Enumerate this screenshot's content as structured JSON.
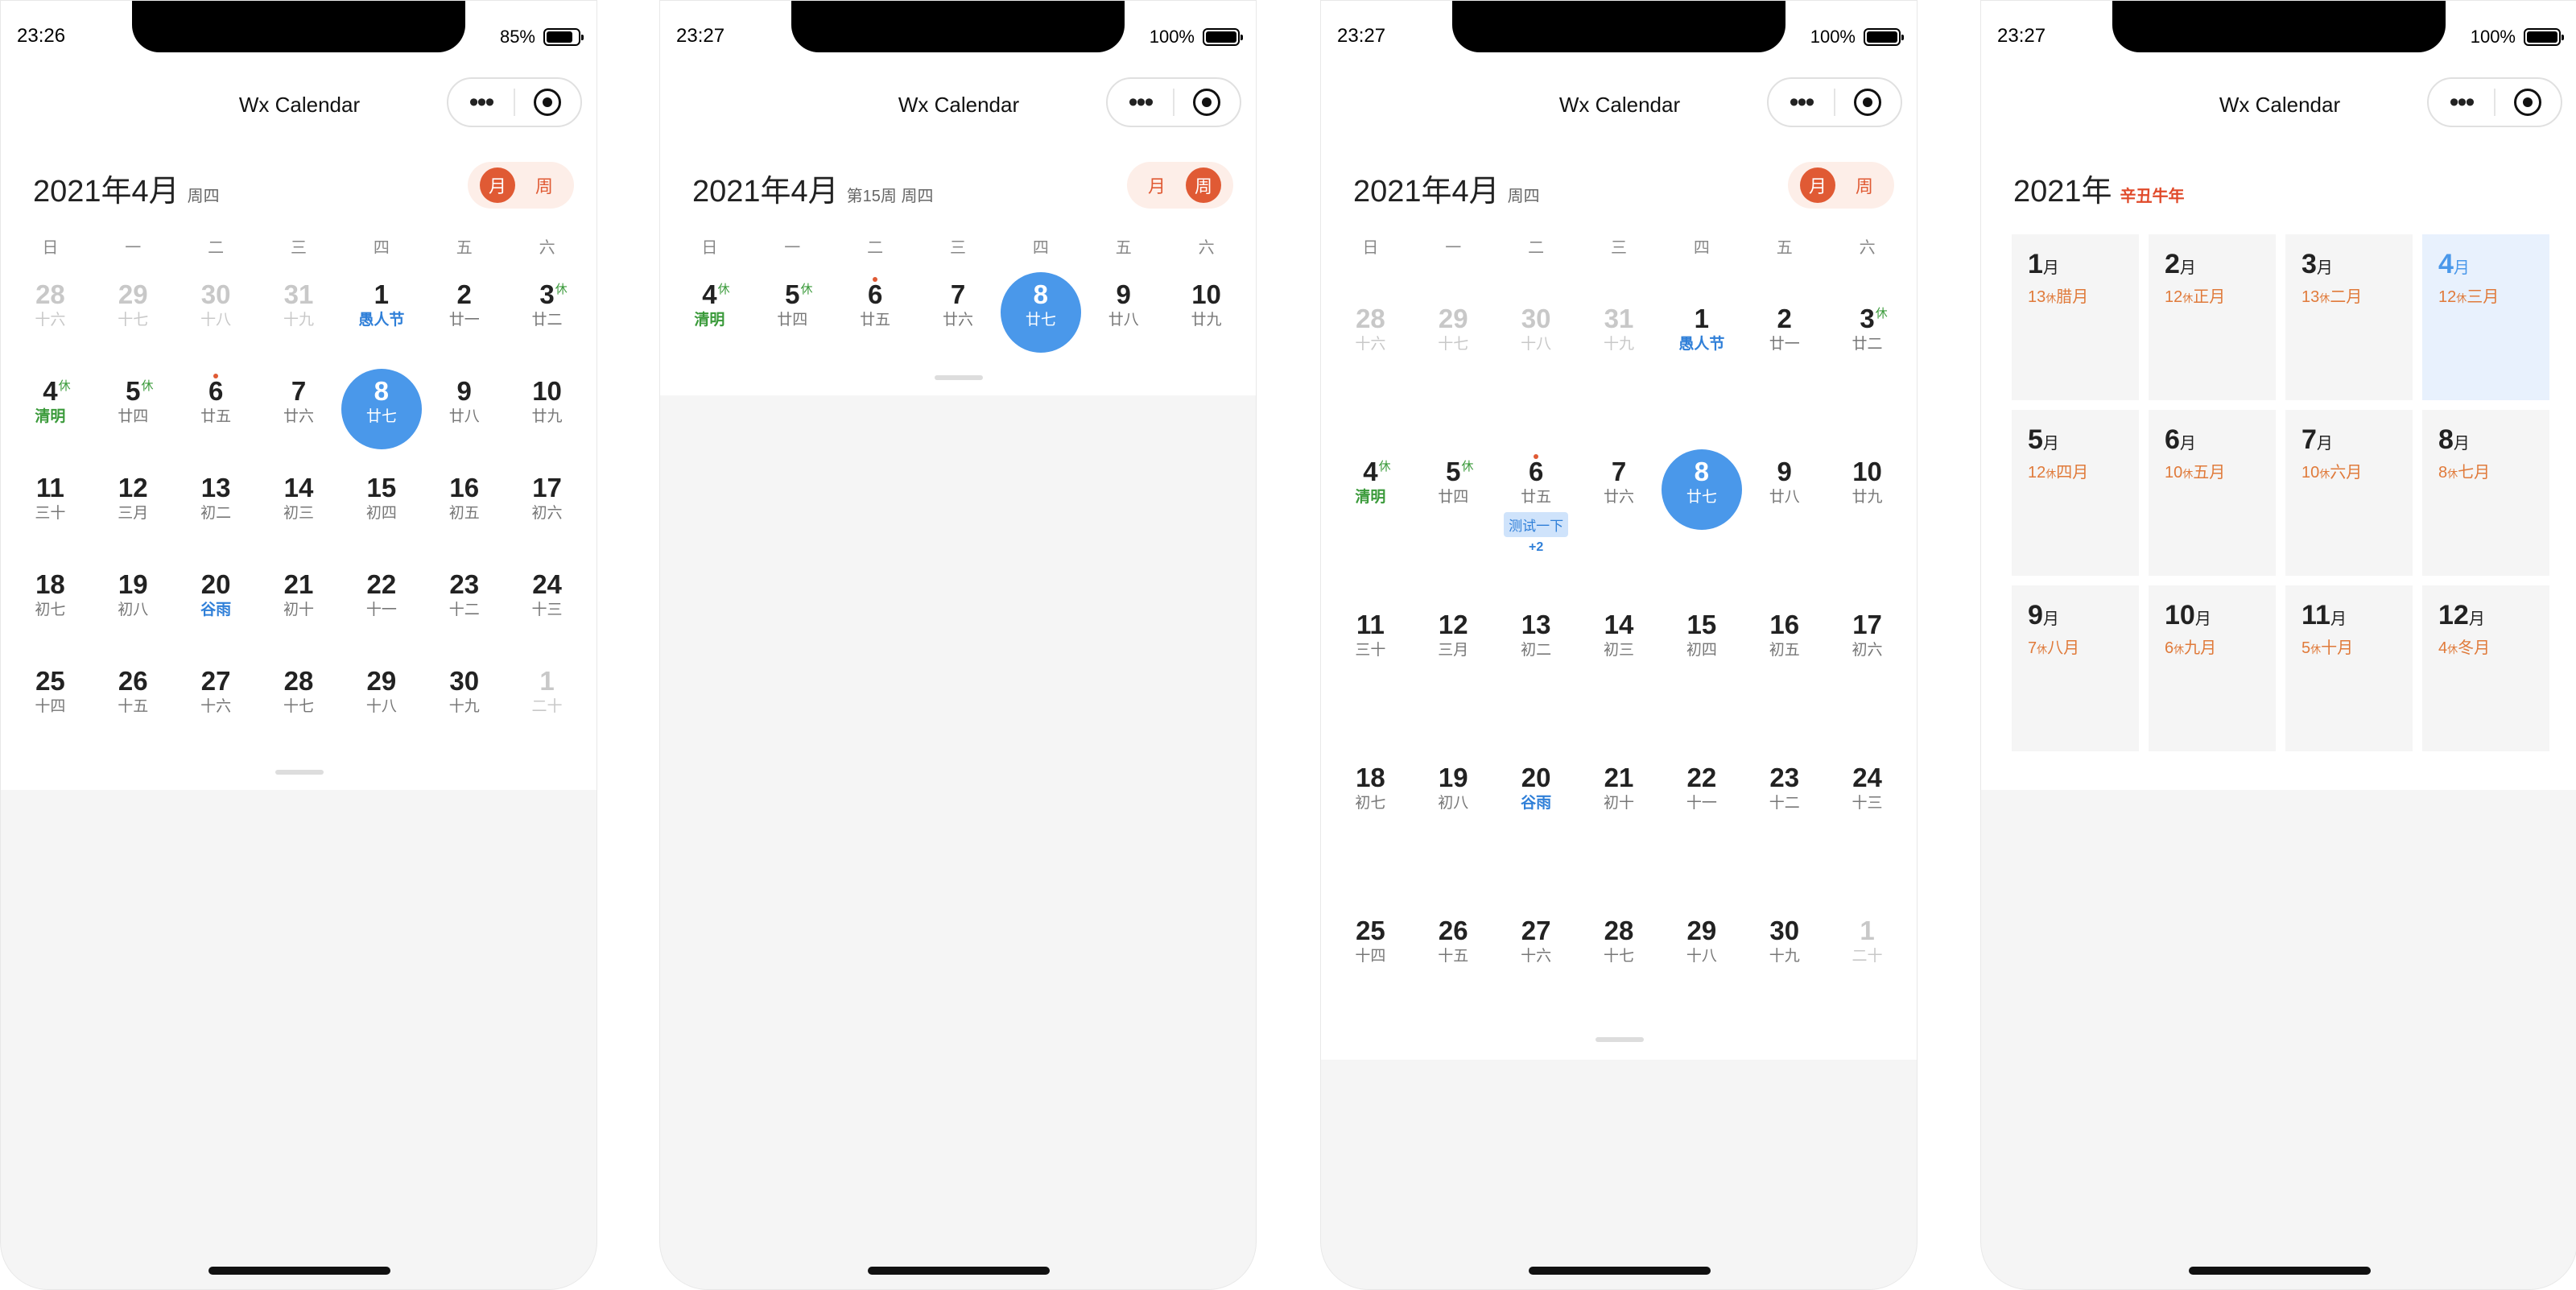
{
  "app_title": "Wx Calendar",
  "capsule": {
    "more": "•••"
  },
  "weekdays": [
    "日",
    "一",
    "二",
    "三",
    "四",
    "五",
    "六"
  ],
  "switch": {
    "month": "月",
    "week": "周"
  },
  "screens": [
    {
      "status": {
        "time": "23:26",
        "battery": "85%",
        "battery_level": 0.85
      },
      "header": {
        "year_month": "2021年4月",
        "sub": "周四"
      },
      "mode": "month"
    },
    {
      "status": {
        "time": "23:27",
        "battery": "100%",
        "battery_level": 1.0
      },
      "header": {
        "year_month": "2021年4月",
        "sub": "第15周 周四"
      },
      "mode": "week"
    },
    {
      "status": {
        "time": "23:27",
        "battery": "100%",
        "battery_level": 1.0
      },
      "header": {
        "year_month": "2021年4月",
        "sub": "周四"
      },
      "mode": "month",
      "event": {
        "label": "测试一下",
        "more": "+2"
      }
    },
    {
      "status": {
        "time": "23:27",
        "battery": "100%",
        "battery_level": 1.0
      },
      "header": {
        "year_month": "2021年",
        "sub": "辛丑牛年"
      },
      "mode": "year"
    }
  ],
  "month_days": [
    [
      {
        "d": "28",
        "l": "十六",
        "dim": true
      },
      {
        "d": "29",
        "l": "十七",
        "dim": true
      },
      {
        "d": "30",
        "l": "十八",
        "dim": true
      },
      {
        "d": "31",
        "l": "十九",
        "dim": true
      },
      {
        "d": "1",
        "l": "愚人节",
        "fes": true
      },
      {
        "d": "2",
        "l": "廿一"
      },
      {
        "d": "3",
        "l": "廿二",
        "rest": "休"
      }
    ],
    [
      {
        "d": "4",
        "l": "清明",
        "term": true,
        "rest": "休"
      },
      {
        "d": "5",
        "l": "廿四",
        "rest": "休"
      },
      {
        "d": "6",
        "l": "廿五",
        "dot": true
      },
      {
        "d": "7",
        "l": "廿六"
      },
      {
        "d": "8",
        "l": "廿七",
        "sel": true
      },
      {
        "d": "9",
        "l": "廿八"
      },
      {
        "d": "10",
        "l": "廿九"
      }
    ],
    [
      {
        "d": "11",
        "l": "三十"
      },
      {
        "d": "12",
        "l": "三月"
      },
      {
        "d": "13",
        "l": "初二"
      },
      {
        "d": "14",
        "l": "初三"
      },
      {
        "d": "15",
        "l": "初四"
      },
      {
        "d": "16",
        "l": "初五"
      },
      {
        "d": "17",
        "l": "初六"
      }
    ],
    [
      {
        "d": "18",
        "l": "初七"
      },
      {
        "d": "19",
        "l": "初八"
      },
      {
        "d": "20",
        "l": "谷雨",
        "fes": true
      },
      {
        "d": "21",
        "l": "初十"
      },
      {
        "d": "22",
        "l": "十一"
      },
      {
        "d": "23",
        "l": "十二"
      },
      {
        "d": "24",
        "l": "十三"
      }
    ],
    [
      {
        "d": "25",
        "l": "十四"
      },
      {
        "d": "26",
        "l": "十五"
      },
      {
        "d": "27",
        "l": "十六"
      },
      {
        "d": "28",
        "l": "十七"
      },
      {
        "d": "29",
        "l": "十八"
      },
      {
        "d": "30",
        "l": "十九"
      },
      {
        "d": "1",
        "l": "二十",
        "dim": true
      }
    ]
  ],
  "months": [
    {
      "m": "1",
      "u": "月",
      "n": "13",
      "tag": "休",
      "lunar": "腊月"
    },
    {
      "m": "2",
      "u": "月",
      "n": "12",
      "tag": "休",
      "lunar": "正月"
    },
    {
      "m": "3",
      "u": "月",
      "n": "13",
      "tag": "休",
      "lunar": "二月"
    },
    {
      "m": "4",
      "u": "月",
      "n": "12",
      "tag": "休",
      "lunar": "三月",
      "cur": true
    },
    {
      "m": "5",
      "u": "月",
      "n": "12",
      "tag": "休",
      "lunar": "四月"
    },
    {
      "m": "6",
      "u": "月",
      "n": "10",
      "tag": "休",
      "lunar": "五月"
    },
    {
      "m": "7",
      "u": "月",
      "n": "10",
      "tag": "休",
      "lunar": "六月"
    },
    {
      "m": "8",
      "u": "月",
      "n": "8",
      "tag": "休",
      "lunar": "七月"
    },
    {
      "m": "9",
      "u": "月",
      "n": "7",
      "tag": "休",
      "lunar": "八月"
    },
    {
      "m": "10",
      "u": "月",
      "n": "6",
      "tag": "休",
      "lunar": "九月"
    },
    {
      "m": "11",
      "u": "月",
      "n": "5",
      "tag": "休",
      "lunar": "十月"
    },
    {
      "m": "12",
      "u": "月",
      "n": "4",
      "tag": "休",
      "lunar": "冬月"
    }
  ]
}
